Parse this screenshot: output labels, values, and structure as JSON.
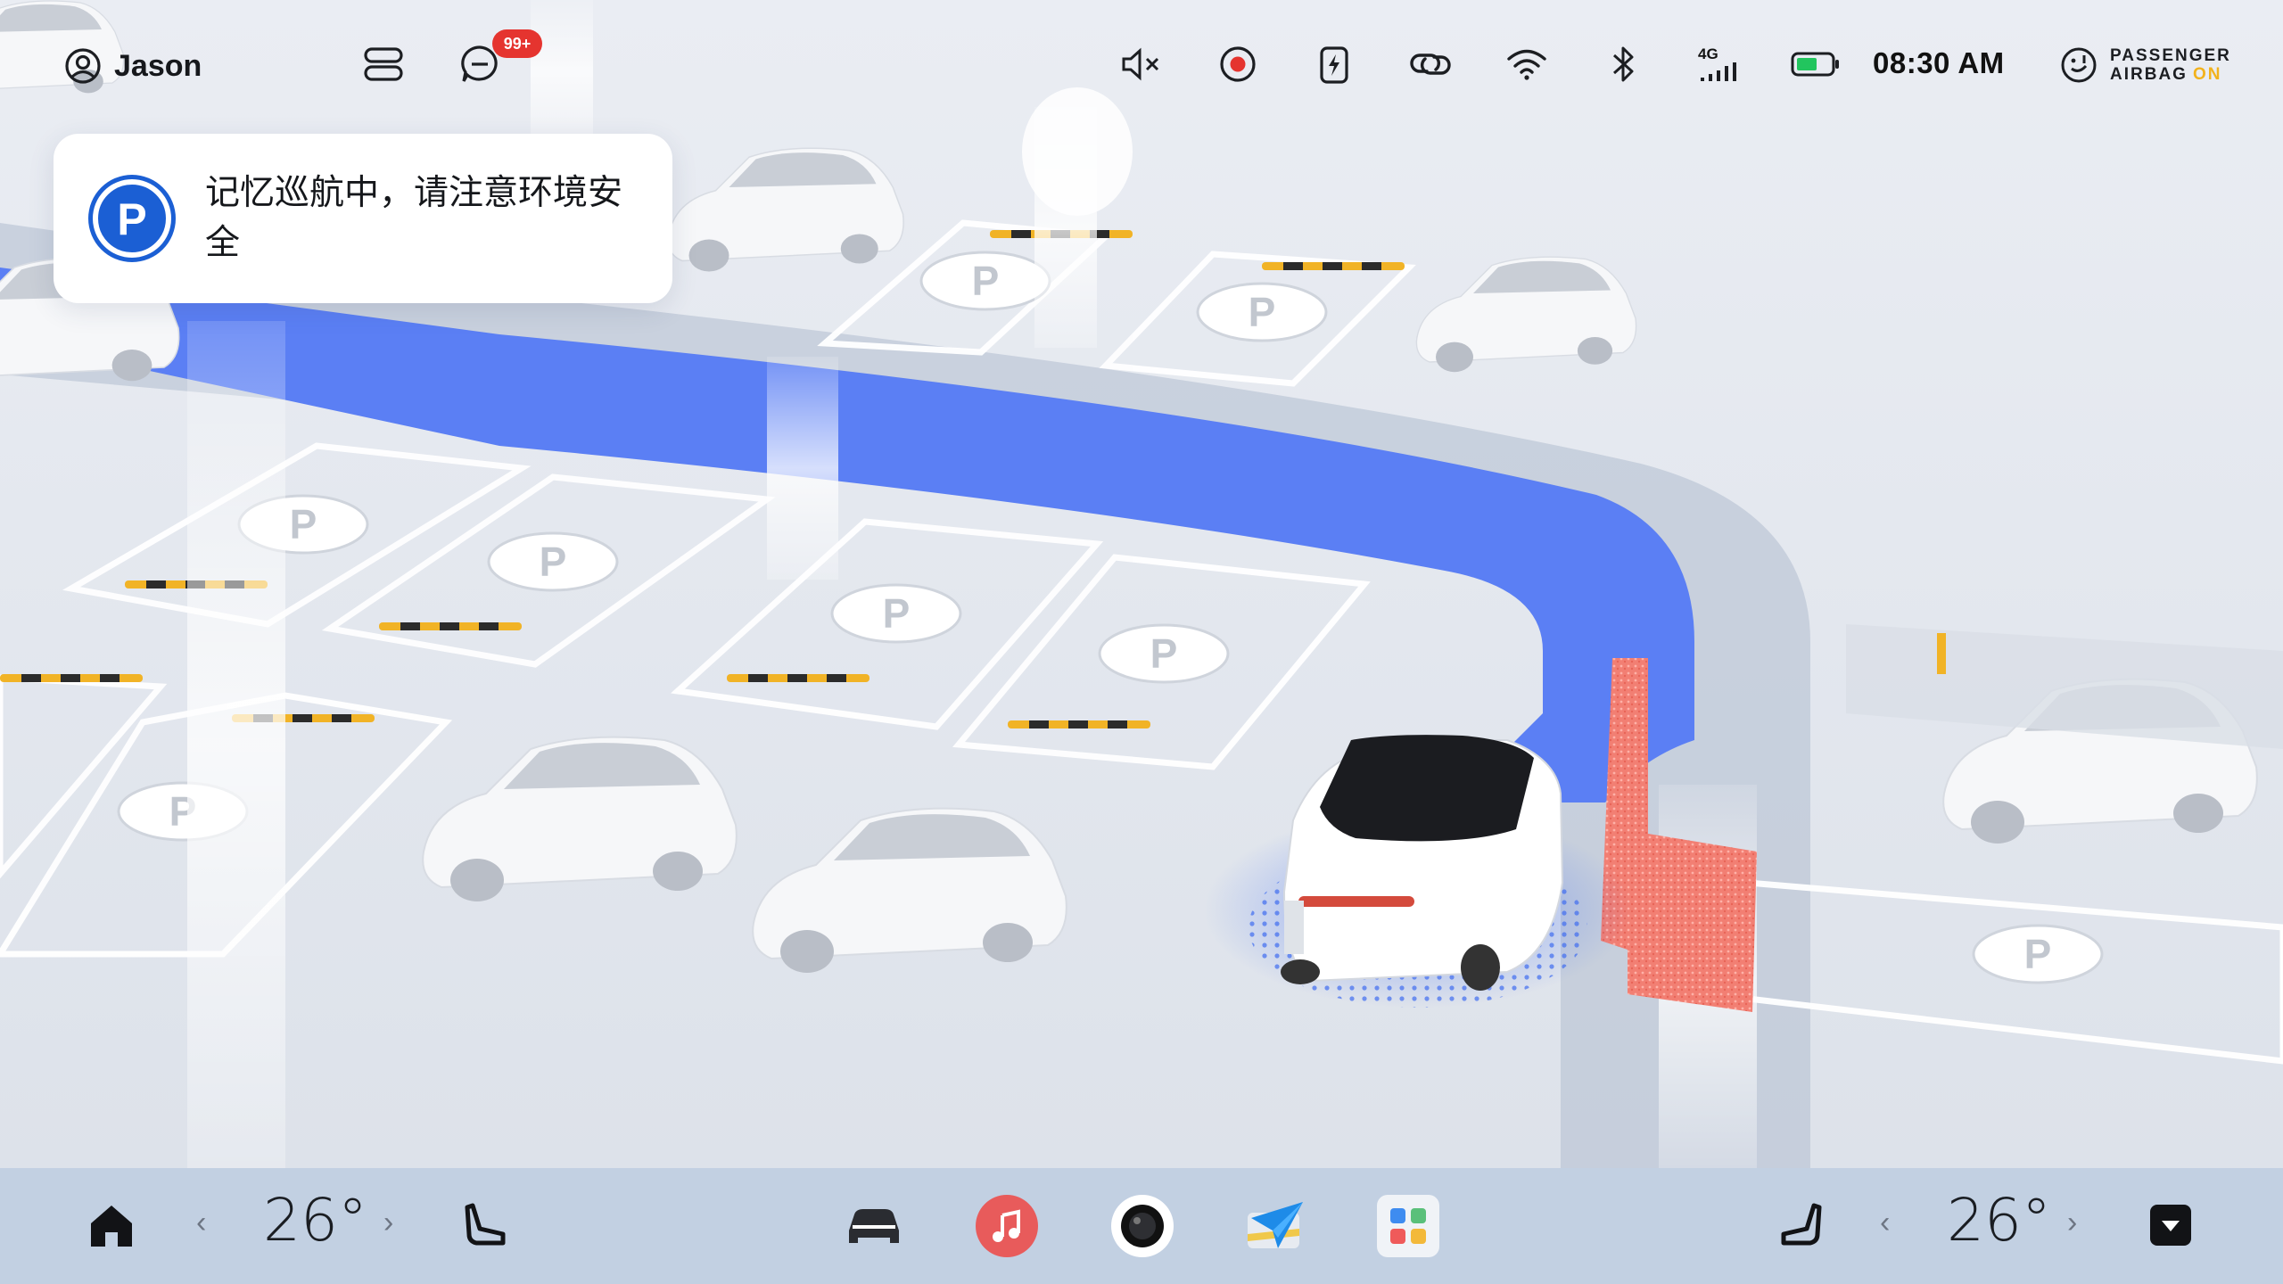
{
  "status_bar": {
    "user_name": "Jason",
    "user_icon": "user-circle-icon",
    "notification_badge": "99+",
    "time": "08:30  AM",
    "network": "4G",
    "passenger_airbag_line1": "PASSENGER",
    "passenger_airbag_line2": "AIRBAG",
    "passenger_airbag_state": "ON",
    "icons": [
      "control-center-icon",
      "message-icon",
      "mute-icon",
      "record-icon",
      "charging-icon",
      "link-icon",
      "wifi-icon",
      "bluetooth-icon",
      "cellular-signal-icon",
      "battery-icon",
      "airbag-icon"
    ],
    "battery_level": 0.6
  },
  "notification": {
    "icon": "parking-icon",
    "icon_letter": "P",
    "text": "记忆巡航中，请注意环境安全"
  },
  "dock": {
    "left_temp": "26°",
    "right_temp": "26°",
    "left_dec": "‹",
    "left_inc": "›",
    "right_dec": "‹",
    "right_inc": "›",
    "apps": [
      "home-icon",
      "left-seat-icon",
      "vehicle-icon",
      "music-icon",
      "camera-icon",
      "navigation-icon",
      "app-grid-icon",
      "right-seat-icon",
      "dropdown-icon"
    ]
  },
  "colors": {
    "route_blue": "#5b7ff4",
    "obstacle_red": "#f07a6e",
    "dock_bg": "#c2d0e2",
    "badge_red": "#e5342f",
    "battery_green": "#22c55e",
    "airbag_on": "#f2b21c",
    "music_app": "#e85b5b"
  }
}
